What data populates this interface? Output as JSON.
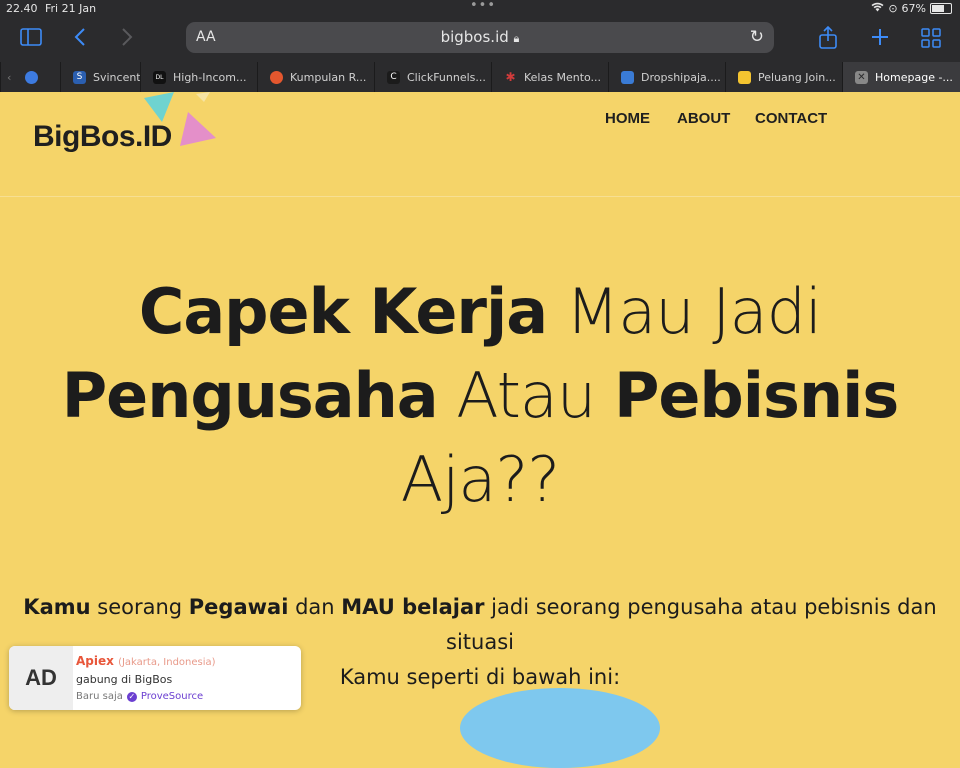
{
  "status_bar": {
    "time": "22.40",
    "date": "Fri 21 Jan",
    "battery": "67%"
  },
  "browser": {
    "text_size_label": "AA",
    "url": "bigbos.id",
    "tabs": [
      {
        "label": "Svincent",
        "icon": "svincent-favicon",
        "color": "#2b5fb0"
      },
      {
        "label": "High-Incom...",
        "icon": "dan-lok-favicon",
        "color": "#111111"
      },
      {
        "label": "Kumpulan R...",
        "icon": "kumpulan-favicon",
        "color": "#e4572e"
      },
      {
        "label": "ClickFunnels...",
        "icon": "clickfunnels-favicon",
        "color": "#1b1b1b"
      },
      {
        "label": "Kelas Mento...",
        "icon": "kelas-favicon",
        "color": "#d13b3b"
      },
      {
        "label": "Dropshipaja....",
        "icon": "dropshipaja-favicon",
        "color": "#3a7bd5"
      },
      {
        "label": "Peluang Join...",
        "icon": "peluang-favicon",
        "color": "#f4c430"
      },
      {
        "label": "Homepage -...",
        "icon": "close-tab-icon",
        "color": "#888888",
        "active": true
      }
    ]
  },
  "site": {
    "logo": "BigBos.ID",
    "nav": [
      "HOME",
      "ABOUT",
      "CONTACT"
    ],
    "hero": {
      "p1": "Capek Kerja",
      "p2": " Mau Jadi",
      "p3": "Pengusaha",
      "p4": " Atau ",
      "p5": "Pebisnis",
      "p6": "Aja??"
    },
    "sub": {
      "s1": "Kamu",
      "s2": " seorang ",
      "s3": "Pegawai",
      "s4": " dan  ",
      "s5": "MAU belajar",
      "s6": " jadi seorang pengusaha atau pebisnis dan situasi",
      "s7": "Kamu seperti di bawah ini:"
    }
  },
  "ad_popup": {
    "badge": "AD",
    "name": "Apiex",
    "location": "(Jakarta, Indonesia)",
    "message": "gabung di BigBos",
    "time": "Baru saja",
    "brand": "ProveSource"
  }
}
